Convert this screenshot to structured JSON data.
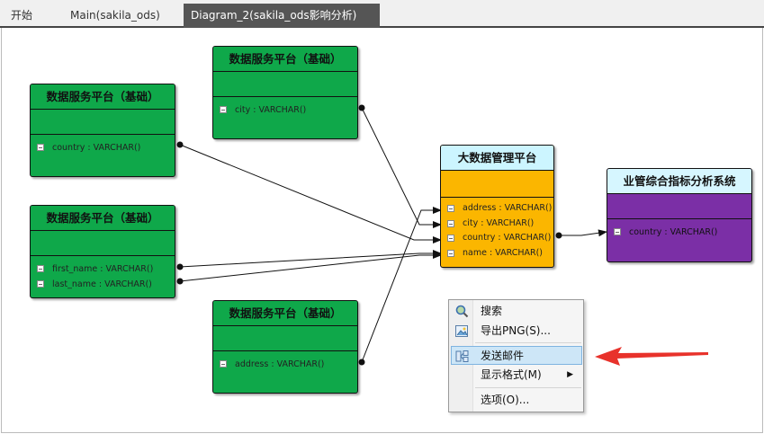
{
  "tabs": [
    {
      "label": "开始",
      "active": false
    },
    {
      "label": "Main(sakila_ods)",
      "active": false
    },
    {
      "label": "Diagram_2(sakila_ods影响分析)",
      "active": true
    }
  ],
  "tab_close_glyph": "✕",
  "entities": {
    "e1": {
      "title": "数据服务平台（基础）",
      "fields": [
        "country : VARCHAR()"
      ]
    },
    "e2": {
      "title": "数据服务平台（基础）",
      "fields": [
        "city : VARCHAR()"
      ]
    },
    "e3": {
      "title": "数据服务平台（基础）",
      "fields": [
        "first_name : VARCHAR()",
        "last_name : VARCHAR()"
      ]
    },
    "e4": {
      "title": "数据服务平台（基础）",
      "fields": [
        "address : VARCHAR()"
      ]
    },
    "e5": {
      "title": "大数据管理平台",
      "fields": [
        "address : VARCHAR()",
        "city : VARCHAR()",
        "country : VARCHAR()",
        "name : VARCHAR()"
      ]
    },
    "e6": {
      "title": "业管综合指标分析系统",
      "fields": [
        "country : VARCHAR()"
      ]
    }
  },
  "colors": {
    "source_entity": "#0fa84a",
    "hub_entity": "#fbb600",
    "target_entity": "#7b2fa6",
    "arrow_annotation": "#e8322b"
  },
  "context_menu": {
    "items": [
      {
        "label": "搜索",
        "icon": "search-icon"
      },
      {
        "label": "导出PNG(S)...",
        "icon": "image-export-icon"
      },
      {
        "label": "发送邮件",
        "icon": "send-mail-icon",
        "highlighted": true
      },
      {
        "label": "显示格式(M)",
        "icon": "",
        "submenu": true
      },
      {
        "label": "选项(O)...",
        "icon": ""
      }
    ]
  }
}
